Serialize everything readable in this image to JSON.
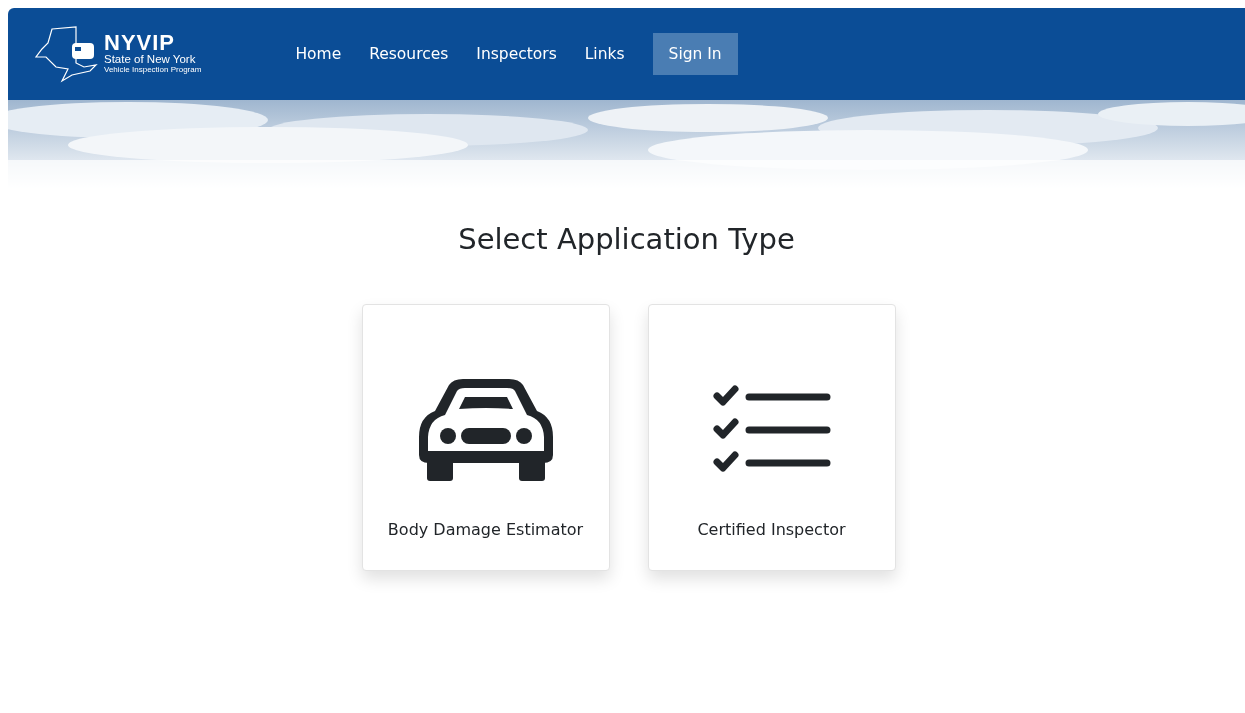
{
  "logo": {
    "title": "NYVIP",
    "subtitle": "State of New York",
    "tagline": "Vehicle Inspection Program"
  },
  "nav": [
    {
      "label": "Home",
      "kind": "link"
    },
    {
      "label": "Resources",
      "kind": "link"
    },
    {
      "label": "Inspectors",
      "kind": "link"
    },
    {
      "label": "Links",
      "kind": "link"
    },
    {
      "label": "Sign In",
      "kind": "button"
    }
  ],
  "heading": "Select Application Type",
  "cards": [
    {
      "label": "Body Damage Estimator",
      "kind": "car"
    },
    {
      "label": "Certified Inspector",
      "kind": "checklist"
    }
  ]
}
